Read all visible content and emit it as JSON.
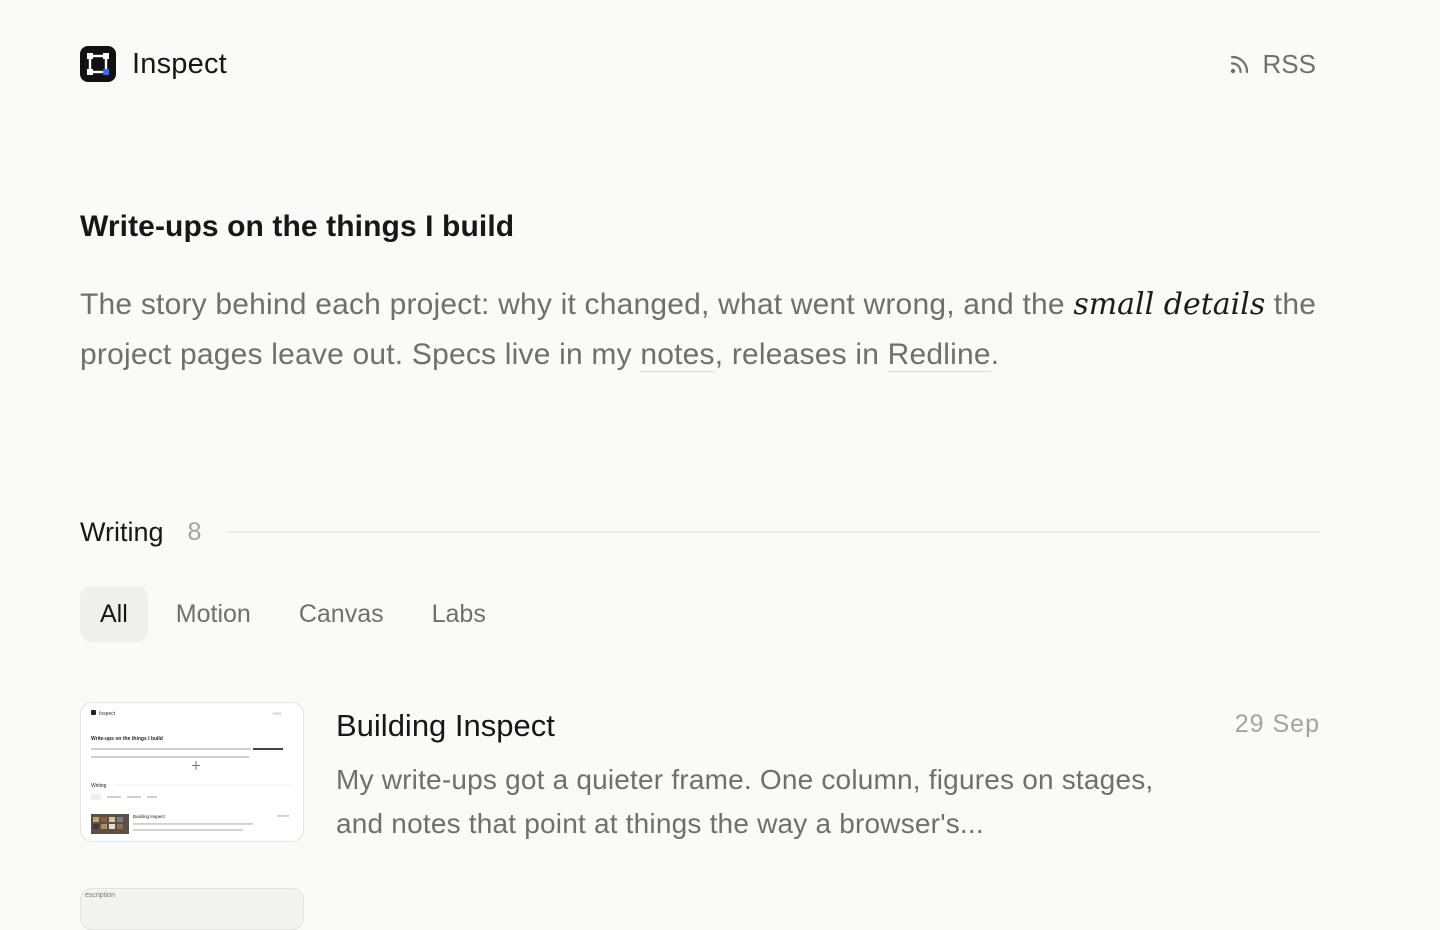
{
  "header": {
    "brand_name": "Inspect",
    "rss_label": "RSS"
  },
  "intro": {
    "title": "Write-ups on the things I build",
    "text_before": "The story behind each project: why it changed, what went wrong, and the ",
    "emphasis": "small details",
    "text_middle": " the project pages leave out. Specs live in my ",
    "link_notes": "notes",
    "text_between": ", releases in ",
    "link_redline": "Redline",
    "text_end": "."
  },
  "section": {
    "title": "Writing",
    "count": "8"
  },
  "tabs": [
    {
      "label": "All",
      "active": true
    },
    {
      "label": "Motion",
      "active": false
    },
    {
      "label": "Canvas",
      "active": false
    },
    {
      "label": "Labs",
      "active": false
    }
  ],
  "posts": [
    {
      "title": "Building Inspect",
      "date": "29  Sep",
      "excerpt": "My write-ups got a quieter frame. One column, figures on stages, and notes that point at things the way a browser's...",
      "thumb": {
        "brand": "Inspect",
        "rss": "RSS",
        "title": "Write-ups on the things I build",
        "section": "Writing",
        "post": "Building Inspect"
      }
    },
    {
      "thumb": {
        "caption": "escription"
      }
    }
  ],
  "colors": {
    "background": "#fafaf9",
    "text_primary": "#171717",
    "text_muted": "#6f6f6f",
    "tab_active_bg": "#efefec"
  }
}
